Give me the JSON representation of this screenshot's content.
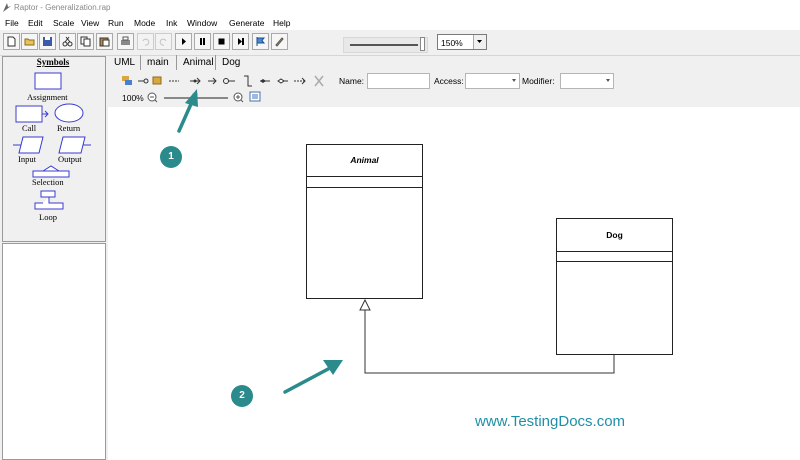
{
  "window": {
    "title": "Raptor - Generalization.rap"
  },
  "menu": [
    "File",
    "Edit",
    "Scale",
    "View",
    "Run",
    "Mode",
    "Ink",
    "Window",
    "Generate",
    "Help"
  ],
  "toolbar": {
    "zoom_value": "150%"
  },
  "symbols": {
    "title": "Symbols",
    "items": [
      "Assignment",
      "Call",
      "Return",
      "Input",
      "Output",
      "Selection",
      "Loop"
    ]
  },
  "tabs": [
    "UML",
    "main",
    "Animal",
    "Dog"
  ],
  "uml_toolbar": {
    "name_label": "Name:",
    "access_label": "Access:",
    "modifier_label": "Modifier:"
  },
  "zoom": {
    "level": "100%"
  },
  "diagram": {
    "classes": [
      {
        "name": "Animal"
      },
      {
        "name": "Dog"
      }
    ]
  },
  "annotations": {
    "badge1": "1",
    "badge2": "2",
    "accent": "#2a8a8c"
  },
  "watermark": "www.TestingDocs.com"
}
